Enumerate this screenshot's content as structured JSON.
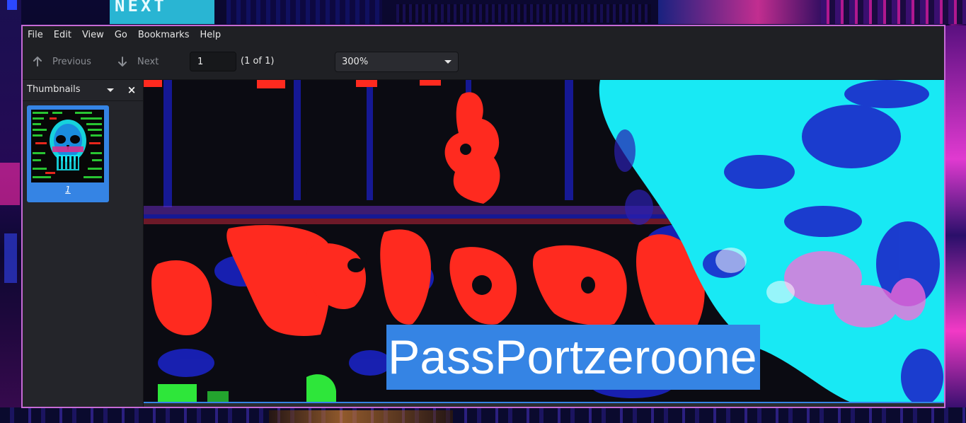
{
  "wallpaper": {
    "text": "NEXT"
  },
  "menubar": {
    "items": [
      "File",
      "Edit",
      "View",
      "Go",
      "Bookmarks",
      "Help"
    ]
  },
  "toolbar": {
    "previous_label": "Previous",
    "next_label": "Next",
    "page_value": "1",
    "page_count": "(1 of 1)",
    "zoom_value": "300%"
  },
  "sidebar": {
    "title": "Thumbnails",
    "close_symbol": "×",
    "thumbnails": [
      {
        "label": "1"
      }
    ]
  },
  "document": {
    "selected_text": "PassPortzeroone"
  },
  "colors": {
    "window_border": "#c66ad6",
    "selection_blue": "#3584e4",
    "chrome_bg": "#1f2024",
    "art_red": "#ff2a1f",
    "art_cyan": "#18e9f4",
    "art_blue": "#1c1ec8",
    "art_green": "#2ee63a"
  },
  "icons": {
    "previous": "arrow-up-icon",
    "next": "arrow-down-icon",
    "zoom_dropdown": "chevron-down-icon",
    "sidebar_dropdown": "chevron-down-icon",
    "sidebar_close": "close-icon"
  }
}
